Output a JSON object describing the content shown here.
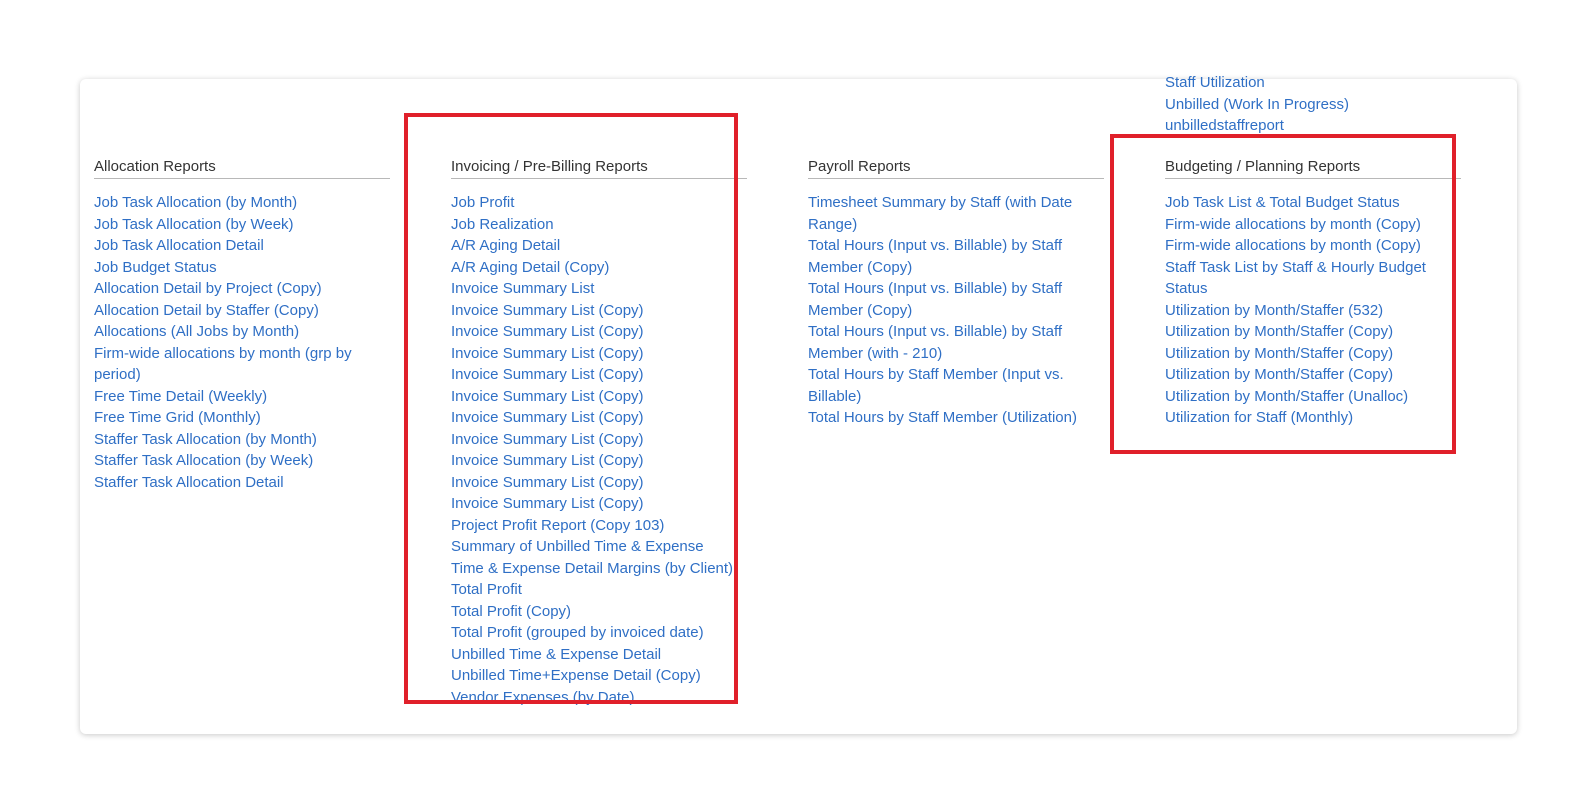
{
  "overflow_links": [
    "Staff Utilization",
    "Unbilled (Work In Progress)",
    "unbilledstaffreport"
  ],
  "columns": {
    "allocation": {
      "title": "Allocation Reports",
      "items": [
        "Job Task Allocation (by Month)",
        "Job Task Allocation (by Week)",
        "Job Task Allocation Detail",
        "Job Budget Status",
        "Allocation Detail by Project (Copy)",
        "Allocation Detail by Staffer (Copy)",
        "Allocations (All Jobs by Month)",
        "Firm-wide allocations by month (grp by period)",
        "Free Time Detail (Weekly)",
        "Free Time Grid (Monthly)",
        "Staffer Task Allocation (by Month)",
        "Staffer Task Allocation (by Week)",
        "Staffer Task Allocation Detail"
      ]
    },
    "invoicing": {
      "title": "Invoicing / Pre-Billing Reports",
      "items": [
        "Job Profit",
        "Job Realization",
        "A/R Aging Detail",
        "A/R Aging Detail (Copy)",
        "Invoice Summary List",
        "Invoice Summary List (Copy)",
        "Invoice Summary List (Copy)",
        "Invoice Summary List (Copy)",
        "Invoice Summary List (Copy)",
        "Invoice Summary List (Copy)",
        "Invoice Summary List (Copy)",
        "Invoice Summary List (Copy)",
        "Invoice Summary List (Copy)",
        "Invoice Summary List (Copy)",
        "Invoice Summary List (Copy)",
        "Project Profit Report (Copy 103)",
        "Summary of Unbilled Time & Expense",
        "Time & Expense Detail Margins (by Client)",
        "Total Profit",
        "Total Profit (Copy)",
        "Total Profit (grouped by invoiced date)",
        "Unbilled Time & Expense Detail",
        "Unbilled Time+Expense Detail (Copy)",
        "Vendor Expenses (by Date)"
      ]
    },
    "payroll": {
      "title": "Payroll Reports",
      "items": [
        "Timesheet Summary by Staff (with Date Range)",
        "Total Hours (Input vs. Billable) by Staff Member (Copy)",
        "Total Hours (Input vs. Billable) by Staff Member (Copy)",
        "Total Hours (Input vs. Billable) by Staff Member (with - 210)",
        "Total Hours by Staff Member (Input vs. Billable)",
        "Total Hours by Staff Member (Utilization)"
      ]
    },
    "budgeting": {
      "title": "Budgeting / Planning Reports",
      "items": [
        "Job Task List & Total Budget Status",
        "Firm-wide allocations by month (Copy)",
        "Firm-wide allocations by month (Copy)",
        "Staff Task List by Staff & Hourly Budget Status",
        "Utilization by Month/Staffer (532)",
        "Utilization by Month/Staffer (Copy)",
        "Utilization by Month/Staffer (Copy)",
        "Utilization by Month/Staffer (Copy)",
        "Utilization by Month/Staffer (Unalloc)",
        "Utilization for Staff (Monthly)"
      ]
    }
  },
  "colors": {
    "link": "#2f6fc5",
    "header_text": "#333333",
    "highlight": "#e0202a"
  }
}
